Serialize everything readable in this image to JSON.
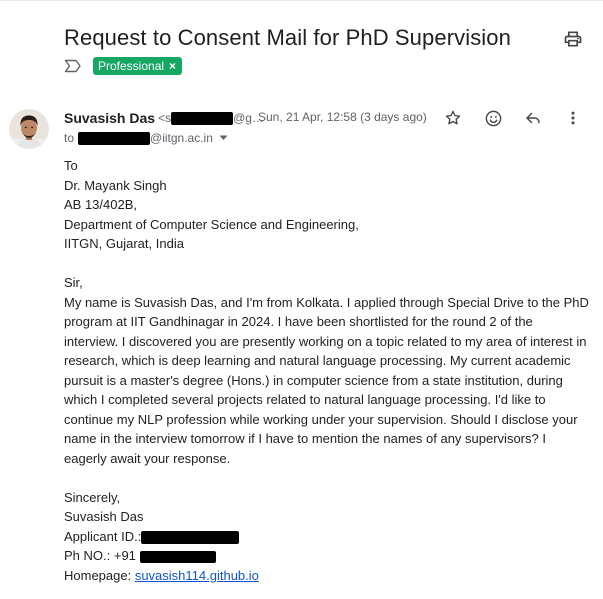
{
  "subject": "Request to Consent Mail for PhD Supervision",
  "labels": [
    {
      "name": "Professional",
      "color": "#16a765",
      "remove": "×"
    }
  ],
  "sender": {
    "name": "Suvasish Das",
    "email_prefix": "<s",
    "email_suffix": "@g…",
    "date": "Sun, 21 Apr, 12:58 (3 days ago)"
  },
  "recipient": {
    "prefix": "to",
    "domain": "@iitgn.ac.in"
  },
  "body": {
    "address": [
      "To",
      "Dr. Mayank Singh",
      "AB 13/402B,",
      "Department of Computer Science and Engineering,",
      "IITGN, Gujarat, India"
    ],
    "salutation": "Sir,",
    "paragraph": "My name is Suvasish Das, and I'm from Kolkata. I applied through Special Drive to the PhD program at IIT Gandhinagar in 2024. I have been shortlisted for the round 2 of the interview. I discovered you are presently working on a topic related to my area of interest in research, which is deep learning and natural language processing. My current academic pursuit is a master's degree (Hons.) in computer science from a state institution, during which I completed several projects related to natural language processing. I'd like to continue my NLP profession while working under your supervision. Should I disclose your name in the interview tomorrow if I have to mention the names of any supervisors? I eagerly await your response.",
    "closing": "Sincerely,",
    "signature_name": "Suvasish Das",
    "applicant_id_label": "Applicant ID.:",
    "phone_label": "Ph NO.: +91",
    "homepage_label": "Homepage: ",
    "homepage_link": "suvasish114.github.io"
  },
  "icons": {
    "print": "printer-icon",
    "important": "importance-marker-icon",
    "star": "star-icon",
    "emoji": "emoji-reaction-icon",
    "reply": "reply-icon",
    "more": "more-vert-icon",
    "recipient_expand": "dropdown-triangle-icon"
  },
  "colors": {
    "label_green": "#16a765",
    "link": "#1155cc",
    "muted": "#5f6368"
  }
}
